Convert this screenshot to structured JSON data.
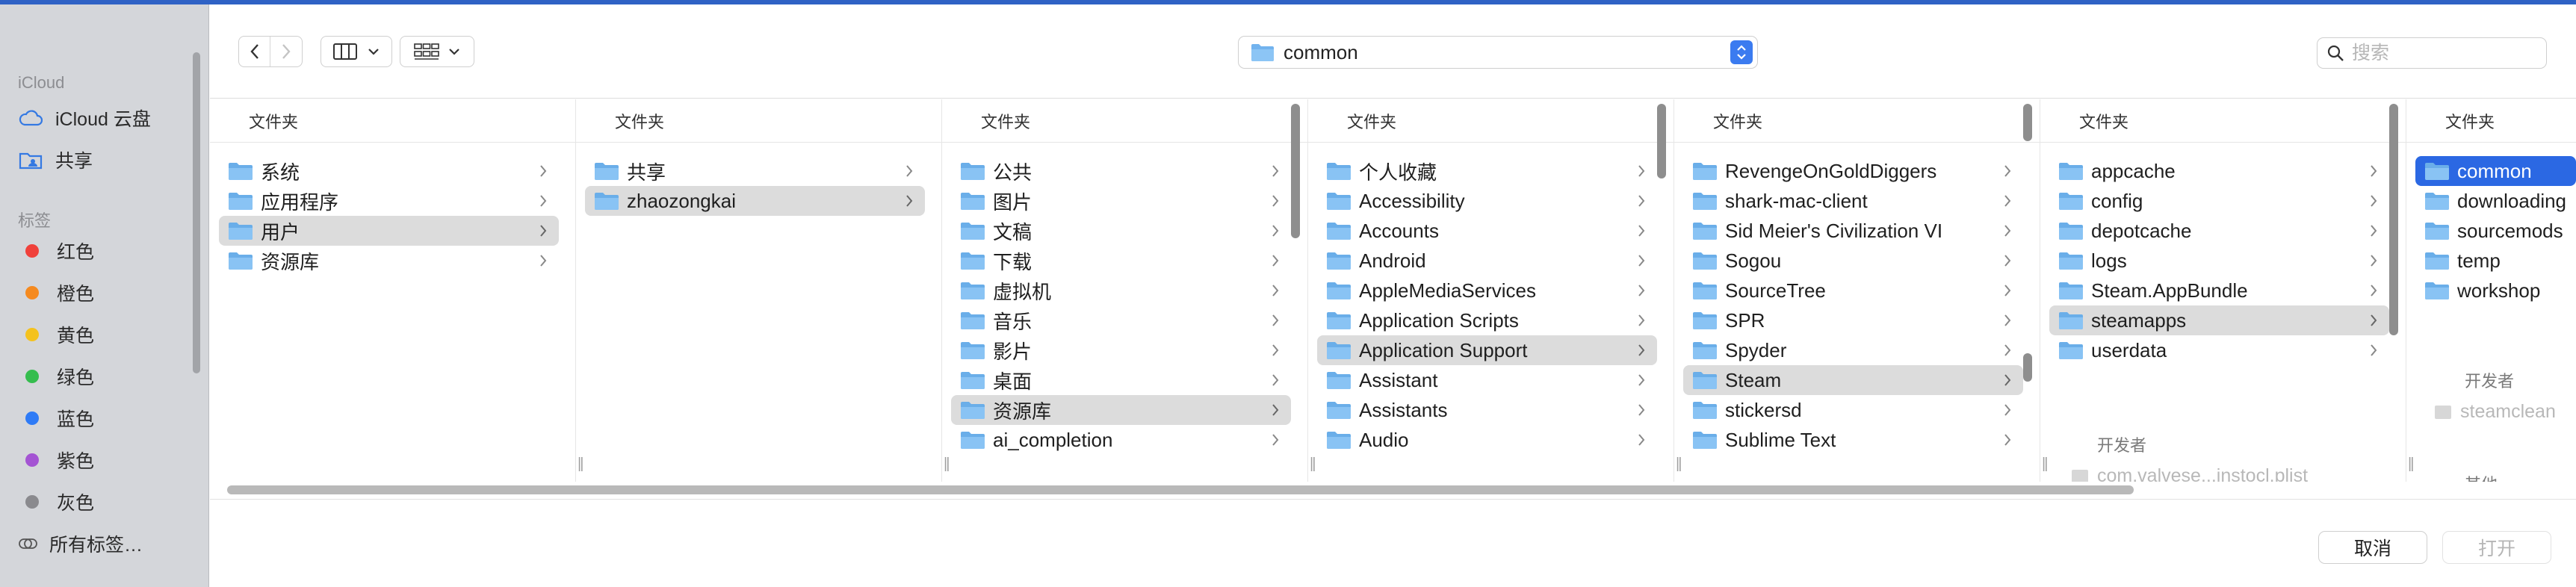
{
  "sidebar": {
    "icloud_header": "iCloud",
    "icloud_drive": "iCloud 云盘",
    "shared": "共享",
    "tags_header": "标签",
    "tags": [
      {
        "label": "红色",
        "color": "#f0413b"
      },
      {
        "label": "橙色",
        "color": "#f58a1f"
      },
      {
        "label": "黄色",
        "color": "#f4c21e"
      },
      {
        "label": "绿色",
        "color": "#35bd4e"
      },
      {
        "label": "蓝色",
        "color": "#2e7bf6"
      },
      {
        "label": "紫色",
        "color": "#a454d3"
      },
      {
        "label": "灰色",
        "color": "#8a8a8e"
      }
    ],
    "all_tags": "所有标签…"
  },
  "toolbar": {
    "path_label": "common",
    "search_placeholder": "搜索"
  },
  "columns": [
    {
      "header": "文件夹",
      "items": [
        {
          "label": "系统",
          "selected": false
        },
        {
          "label": "应用程序",
          "selected": false
        },
        {
          "label": "用户",
          "selected": true
        },
        {
          "label": "资源库",
          "selected": false
        }
      ]
    },
    {
      "header": "文件夹",
      "items": [
        {
          "label": "共享",
          "selected": false
        },
        {
          "label": "zhaozongkai",
          "selected": true
        }
      ]
    },
    {
      "header": "文件夹",
      "items": [
        {
          "label": "公共",
          "selected": false
        },
        {
          "label": "图片",
          "selected": false
        },
        {
          "label": "文稿",
          "selected": false
        },
        {
          "label": "下载",
          "selected": false
        },
        {
          "label": "虚拟机",
          "selected": false
        },
        {
          "label": "音乐",
          "selected": false
        },
        {
          "label": "影片",
          "selected": false
        },
        {
          "label": "桌面",
          "selected": false
        },
        {
          "label": "资源库",
          "selected": true
        },
        {
          "label": "ai_completion",
          "selected": false
        }
      ]
    },
    {
      "header": "文件夹",
      "items": [
        {
          "label": "个人收藏",
          "selected": false
        },
        {
          "label": "Accessibility",
          "selected": false
        },
        {
          "label": "Accounts",
          "selected": false
        },
        {
          "label": "Android",
          "selected": false
        },
        {
          "label": "AppleMediaServices",
          "selected": false
        },
        {
          "label": "Application Scripts",
          "selected": false
        },
        {
          "label": "Application Support",
          "selected": true
        },
        {
          "label": "Assistant",
          "selected": false
        },
        {
          "label": "Assistants",
          "selected": false
        },
        {
          "label": "Audio",
          "selected": false
        }
      ]
    },
    {
      "header": "文件夹",
      "items": [
        {
          "label": "RevengeOnGoldDiggers",
          "selected": false
        },
        {
          "label": "shark-mac-client",
          "selected": false
        },
        {
          "label": "Sid Meier's Civilization VI",
          "selected": false
        },
        {
          "label": "Sogou",
          "selected": false
        },
        {
          "label": "SourceTree",
          "selected": false
        },
        {
          "label": "SPR",
          "selected": false
        },
        {
          "label": "Spyder",
          "selected": false
        },
        {
          "label": "Steam",
          "selected": true
        },
        {
          "label": "stickersd",
          "selected": false
        },
        {
          "label": "Sublime Text",
          "selected": false
        }
      ]
    },
    {
      "header": "文件夹",
      "items": [
        {
          "label": "appcache",
          "selected": false
        },
        {
          "label": "config",
          "selected": false
        },
        {
          "label": "depotcache",
          "selected": false
        },
        {
          "label": "logs",
          "selected": false
        },
        {
          "label": "Steam.AppBundle",
          "selected": false
        },
        {
          "label": "steamapps",
          "selected": true
        },
        {
          "label": "userdata",
          "selected": false
        }
      ],
      "sub_header": "开发者",
      "dim_item": "com.valvese...instocl.plist"
    },
    {
      "header": "文件夹",
      "items": [
        {
          "label": "common",
          "selected": true
        },
        {
          "label": "downloading",
          "selected": false
        },
        {
          "label": "sourcemods",
          "selected": false
        },
        {
          "label": "temp",
          "selected": false
        },
        {
          "label": "workshop",
          "selected": false
        }
      ],
      "sub_header": "开发者",
      "dim_item": "steamclean",
      "extra_header": "其他"
    }
  ],
  "footer": {
    "cancel": "取消",
    "open": "打开"
  }
}
